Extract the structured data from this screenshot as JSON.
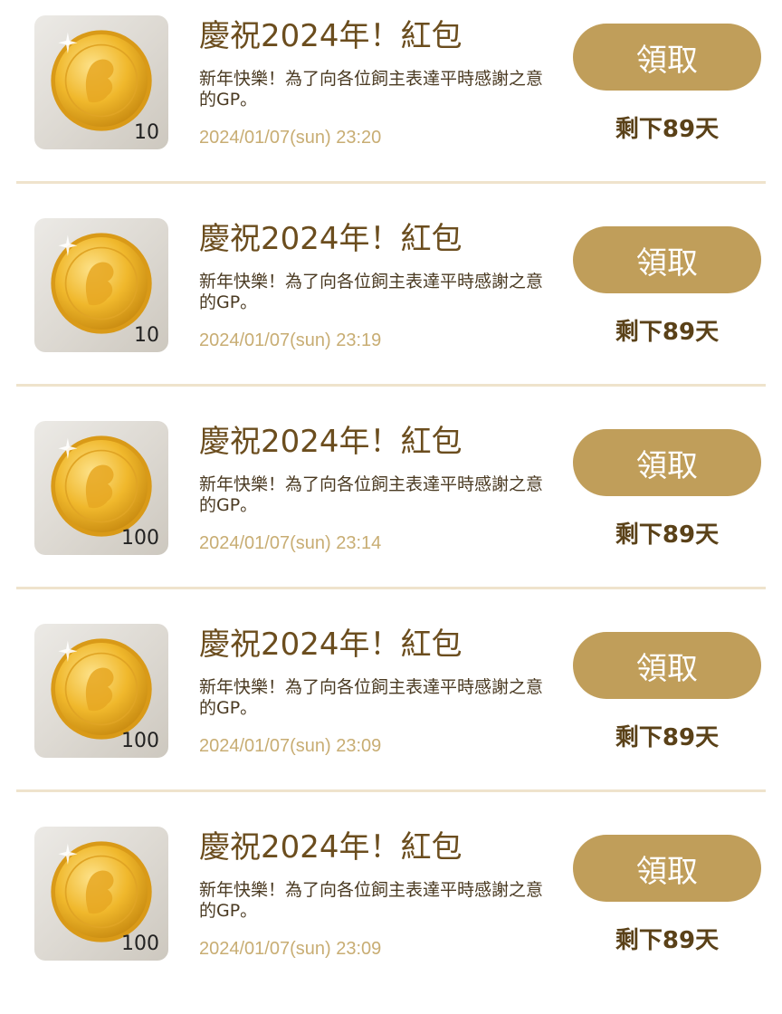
{
  "items": [
    {
      "title": "慶祝2024年！紅包",
      "description": "新年快樂！為了向各位飼主表達平時感謝之意的GP。",
      "date": "2024/01/07(sun) 23:20",
      "amount": "10",
      "button_label": "領取",
      "remaining": "剩下89天"
    },
    {
      "title": "慶祝2024年！紅包",
      "description": "新年快樂！為了向各位飼主表達平時感謝之意的GP。",
      "date": "2024/01/07(sun) 23:19",
      "amount": "10",
      "button_label": "領取",
      "remaining": "剩下89天"
    },
    {
      "title": "慶祝2024年！紅包",
      "description": "新年快樂！為了向各位飼主表達平時感謝之意的GP。",
      "date": "2024/01/07(sun) 23:14",
      "amount": "100",
      "button_label": "領取",
      "remaining": "剩下89天"
    },
    {
      "title": "慶祝2024年！紅包",
      "description": "新年快樂！為了向各位飼主表達平時感謝之意的GP。",
      "date": "2024/01/07(sun) 23:09",
      "amount": "100",
      "button_label": "領取",
      "remaining": "剩下89天"
    },
    {
      "title": "慶祝2024年！紅包",
      "description": "新年快樂！為了向各位飼主表達平時感謝之意的GP。",
      "date": "2024/01/07(sun) 23:09",
      "amount": "100",
      "button_label": "領取",
      "remaining": "剩下89天"
    }
  ],
  "colors": {
    "accent": "#c09e5a",
    "title": "#6b4d1e",
    "date": "#c8ad73",
    "divider": "#efe3cc"
  },
  "icons": {
    "coin": "gold-coin-icon"
  }
}
